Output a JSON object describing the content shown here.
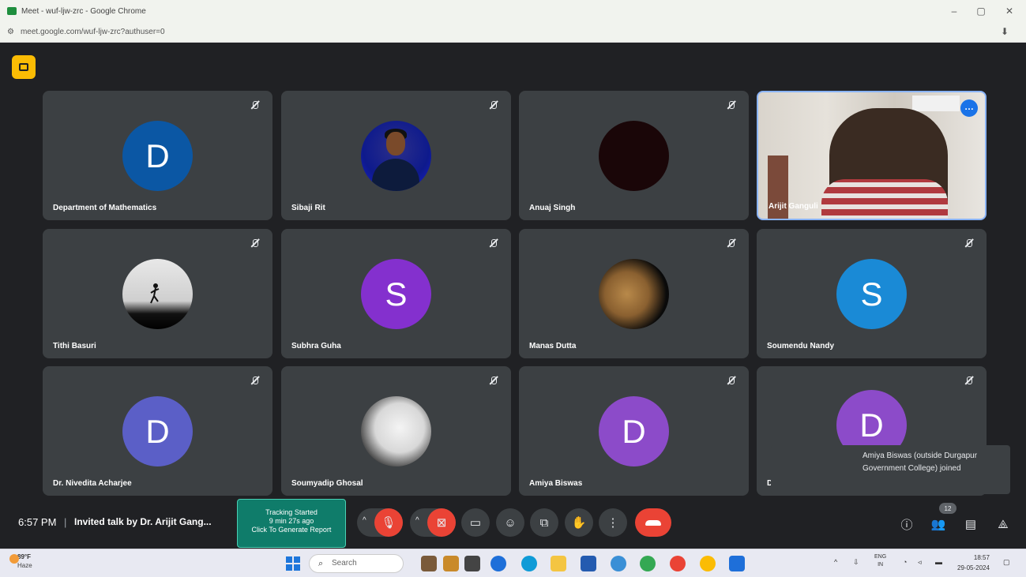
{
  "browser": {
    "tab_title": "Meet - wuf-ljw-zrc - Google Chrome",
    "url": "meet.google.com/wuf-ljw-zrc?authuser=0",
    "controls": {
      "minimize": "–",
      "maximize": "▢",
      "close": "✕"
    }
  },
  "tiles": [
    {
      "name": "Department of Mathematics",
      "initial": "D",
      "avatar_color": "#0b57a4"
    },
    {
      "name": "Sibaji Rit",
      "initial": ""
    },
    {
      "name": "Anuaj Singh",
      "initial": ""
    },
    {
      "name": "Arijit Ganguli",
      "initial": ""
    },
    {
      "name": "Tithi Basuri",
      "initial": ""
    },
    {
      "name": "Subhra Guha",
      "initial": "S",
      "avatar_color": "#8430ce"
    },
    {
      "name": "Manas Dutta",
      "initial": ""
    },
    {
      "name": "Soumendu Nandy",
      "initial": "S",
      "avatar_color": "#1a8ad6"
    },
    {
      "name": "Dr. Nivedita Acharjee",
      "initial": "D",
      "avatar_color": "#5b5fc7"
    },
    {
      "name": "Soumyadip Ghosal",
      "initial": ""
    },
    {
      "name": "Amiya Biswas",
      "initial": "D",
      "avatar_color": "#8c4bc9"
    },
    {
      "name": "D",
      "initial": "D",
      "avatar_color": "#8c4bc9"
    }
  ],
  "toast": {
    "message": "Amiya Biswas (outside Durgapur Government College) joined"
  },
  "bottombar": {
    "time": "6:57 PM",
    "separator": "|",
    "meeting_title": "Invited talk by Dr. Arijit Gang...",
    "tracking": {
      "line1": "Tracking Started",
      "line2": "9 min 27s ago",
      "line3": "Click To Generate Report"
    },
    "participant_count": "12"
  },
  "taskbar": {
    "weather_temp": "89°F",
    "weather_desc": "Haze",
    "search_placeholder": "Search",
    "lang_line1": "ENG",
    "lang_line2": "IN",
    "clock_time": "18:57",
    "clock_date": "29-05-2024"
  },
  "colors": {
    "meet_bg": "#202124",
    "tile_bg": "#3c4043",
    "danger": "#ea4335",
    "accent": "#1a73e8",
    "host_badge": "#fbbc04",
    "tracking": "#0f7c6a"
  },
  "icons": [
    "present-to-all-icon",
    "mic-off-icon",
    "camera-off-icon",
    "captions-icon",
    "emoji-icon",
    "present-icon",
    "raise-hand-icon",
    "more-options-icon",
    "end-call-icon",
    "info-icon",
    "people-icon",
    "chat-icon",
    "activities-icon"
  ]
}
